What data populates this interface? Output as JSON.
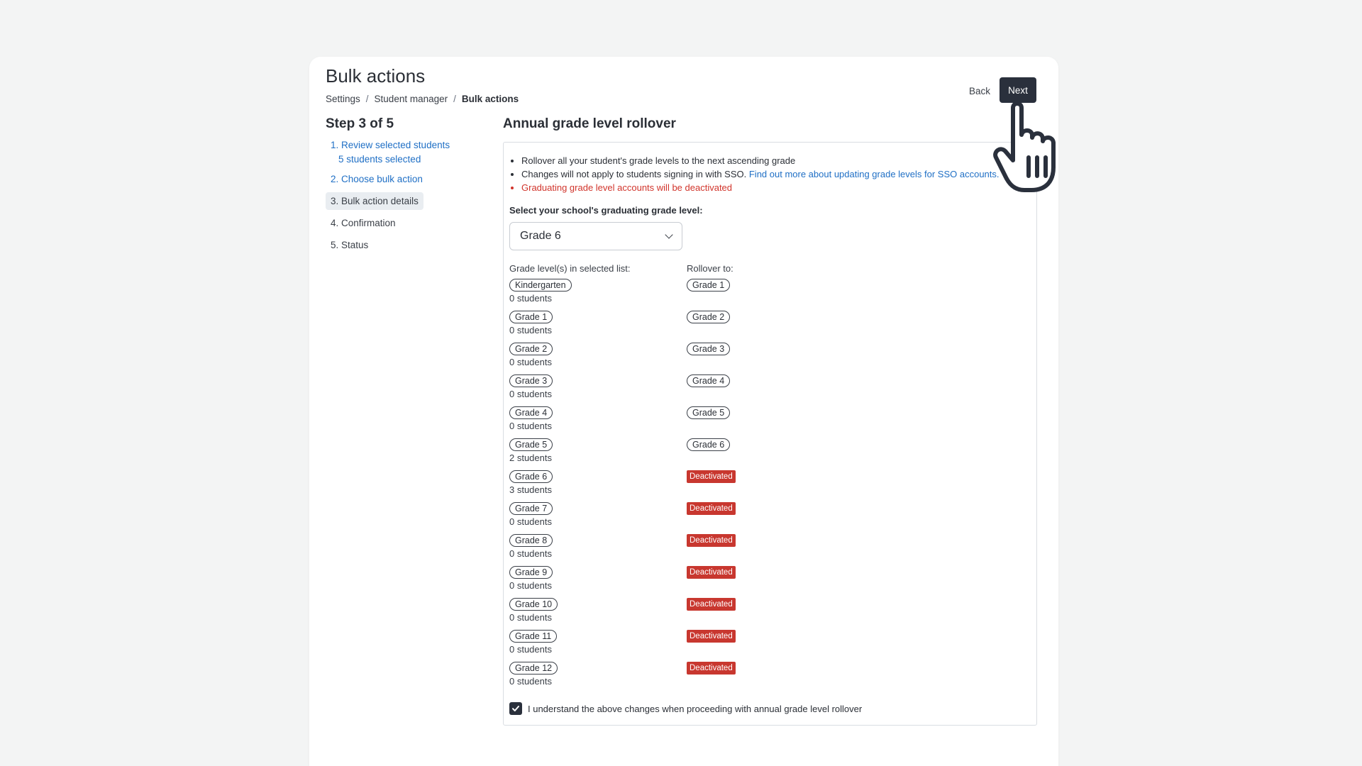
{
  "page": {
    "title": "Bulk actions",
    "breadcrumb": [
      "Settings",
      "Student manager",
      "Bulk actions"
    ],
    "back_label": "Back",
    "next_label": "Next"
  },
  "steps": {
    "title": "Step 3 of 5",
    "items": [
      {
        "label": "1. Review selected students",
        "sub": "5 students selected"
      },
      {
        "label": "2. Choose bulk action"
      },
      {
        "label": "3. Bulk action details"
      },
      {
        "label": "4. Confirmation"
      },
      {
        "label": "5. Status"
      }
    ],
    "active_index": 2
  },
  "main": {
    "title": "Annual grade level rollover",
    "bullets": {
      "b1": "Rollover all your student's grade levels to the next ascending grade",
      "b2": "Changes will not apply to students signing in with SSO.",
      "b2_link": "Find out more about updating grade levels for SSO accounts.",
      "b3": "Graduating grade level accounts will be deactivated"
    },
    "graduating_label": "Select your school's graduating grade level:",
    "graduating_value": "Grade 6",
    "col_from": "Grade level(s) in selected list:",
    "col_to": "Rollover to:",
    "rows": [
      {
        "from": "Kindergarten",
        "count": "0 students",
        "to": "Grade 1"
      },
      {
        "from": "Grade 1",
        "count": "0 students",
        "to": "Grade 2"
      },
      {
        "from": "Grade 2",
        "count": "0 students",
        "to": "Grade 3"
      },
      {
        "from": "Grade 3",
        "count": "0 students",
        "to": "Grade 4"
      },
      {
        "from": "Grade 4",
        "count": "0 students",
        "to": "Grade 5"
      },
      {
        "from": "Grade 5",
        "count": "2 students",
        "to": "Grade 6"
      },
      {
        "from": "Grade 6",
        "count": "3 students",
        "to": "Deactivated"
      },
      {
        "from": "Grade 7",
        "count": "0 students",
        "to": "Deactivated"
      },
      {
        "from": "Grade 8",
        "count": "0 students",
        "to": "Deactivated"
      },
      {
        "from": "Grade 9",
        "count": "0 students",
        "to": "Deactivated"
      },
      {
        "from": "Grade 10",
        "count": "0 students",
        "to": "Deactivated"
      },
      {
        "from": "Grade 11",
        "count": "0 students",
        "to": "Deactivated"
      },
      {
        "from": "Grade 12",
        "count": "0 students",
        "to": "Deactivated"
      }
    ],
    "confirm_label": "I understand the above changes when proceeding with annual grade level rollover",
    "confirm_checked": true
  },
  "colors": {
    "primary_dark": "#2a303c",
    "link": "#1f6fc5",
    "danger": "#c8372f"
  }
}
